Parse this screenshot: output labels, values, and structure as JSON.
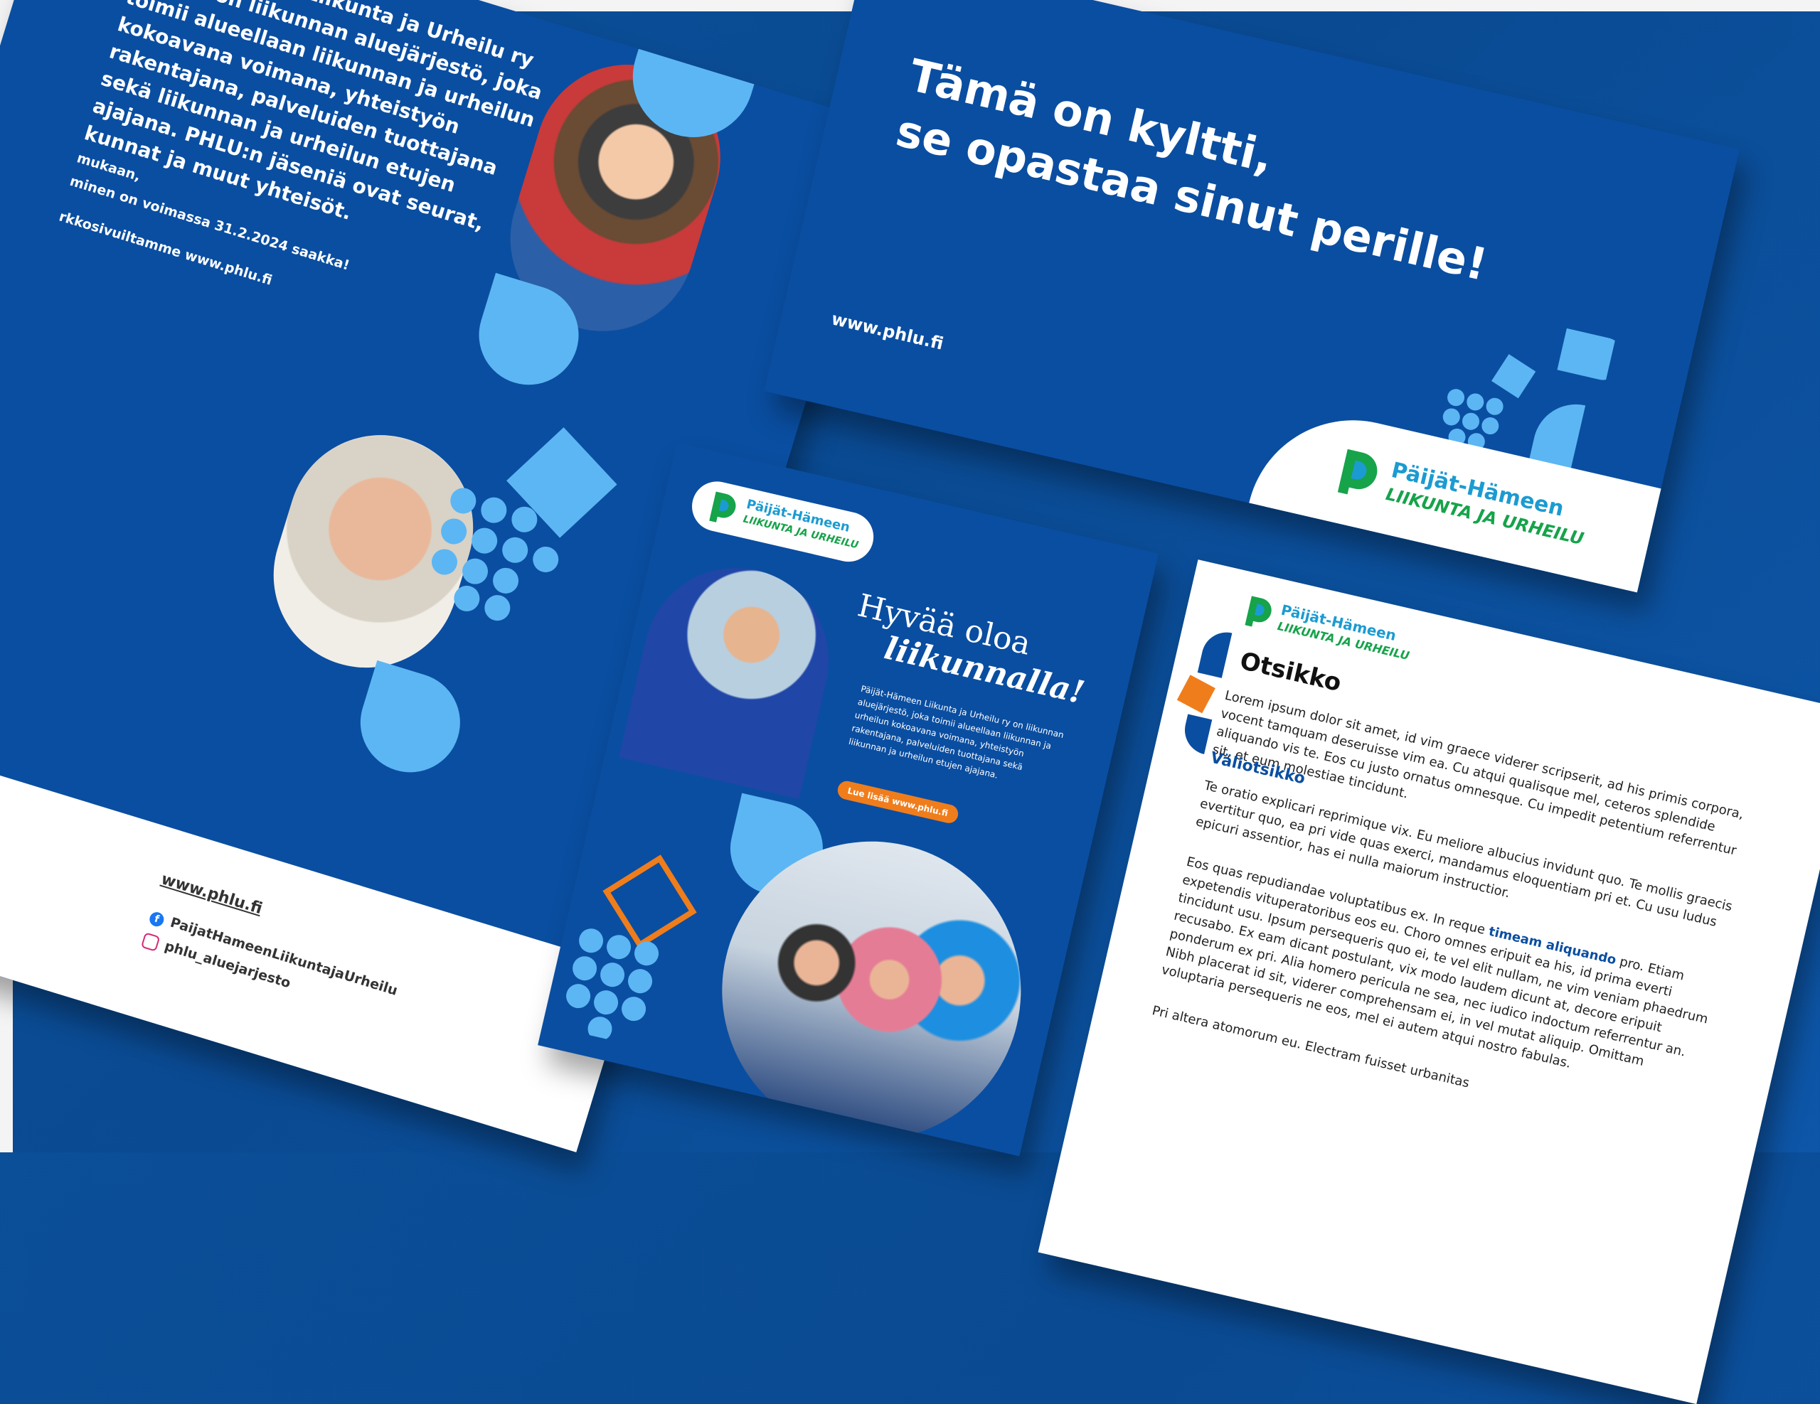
{
  "poster_left": {
    "intro": "Päijät-Hämeen Liikunta ja Urheilu ry (PHLU) on liikunnan aluejärjestö, joka toimii alueellaan liikunnan ja urheilun kokoavana voimana, yhteistyön rakentajana, palveluiden tuottajana sekä liikunnan ja urheilun etujen ajajana. PHLU:n jäseniä ovat seurat, kunnat ja muut yhteisöt.",
    "meta_line1": "mukaan,",
    "meta_line2": "minen on voimassa 31.2.2024 saakka!",
    "meta_line3": "rkkosivuiltamme www.phlu.fi",
    "web": "www.phlu.fi",
    "facebook": "PaijatHameenLiikuntajaUrheilu",
    "instagram": "phlu_aluejarjesto"
  },
  "sign": {
    "line1": "Tämä on kyltti,",
    "line2": "se opastaa sinut perille!",
    "url": "www.phlu.fi",
    "logo_line1": "Päijät-Hämeen",
    "logo_line2": "LIIKUNTA JA URHEILU"
  },
  "flyer": {
    "logo_line1": "Päijät-Hämeen",
    "logo_line2": "LIIKUNTA JA URHEILU",
    "heading1": "Hyvää oloa",
    "heading2": "liikunnalla!",
    "body": "Päijät-Hämeen Liikunta ja Urheilu ry on liikunnan aluejärjestö, joka toimii alueellaan liikunnan ja urheilun kokoavana voimana, yhteistyön rakentajana, palveluiden tuottajana sekä liikunnan ja urheilun etujen ajajana.",
    "cta": "Lue lisää www.phlu.fi"
  },
  "doc": {
    "logo_line1": "Päijät-Hämeen",
    "logo_line2": "LIIKUNTA JA URHEILU",
    "title": "Otsikko",
    "p1": "Lorem ipsum dolor sit amet, id vim graece viderer scripserit, ad his primis corpora, vocent tamquam deseruisse vim ea. Cu atqui qualisque mel, ceteros splendide aliquando vis te. Eos cu justo ornatus omnesque. Cu impedit petentium referrentur sit, et eum molestiae tincidunt.",
    "subtitle": "Väliotsikko",
    "p2": "Te oratio explicari reprimique vix. Eu meliore albucius invidunt quo. Te mollis graecis evertitur quo, ea pri vide quas exerci, mandamus eloquentiam pri et. Cu usu ludus epicuri assentior, has ei nulla maiorum instructior.",
    "p3_start": "Eos quas repudiandae voluptatibus ex. In reque ",
    "p3_highlight": "timeam aliquando",
    "p3_end": " pro. Etiam expetendis vituperatoribus eos eu. Choro omnes eripuit ea his, id prima everti tincidunt usu. Ipsum persequeris quo ei, te vel elit nullam, ne vim veniam phaedrum recusabo. Ex eam dicant postulant, vix modo laudem dicunt at, decore eripuit ponderum ex pri. Alia homero pericula ne sea, nec iudico indoctum referrentur an. Nibh placerat id sit, viderer comprehensam ei, in vel mutat aliquip. Omittam voluptaria persequeris ne eos, mel ei autem atqui nostro fabulas.",
    "p4": "Pri altera atomorum eu. Electram fuisset urbanitas"
  },
  "colors": {
    "brand_blue": "#0a4ea1",
    "light_blue": "#5cb6f3",
    "orange": "#f07d1b",
    "green": "#16a34a"
  }
}
